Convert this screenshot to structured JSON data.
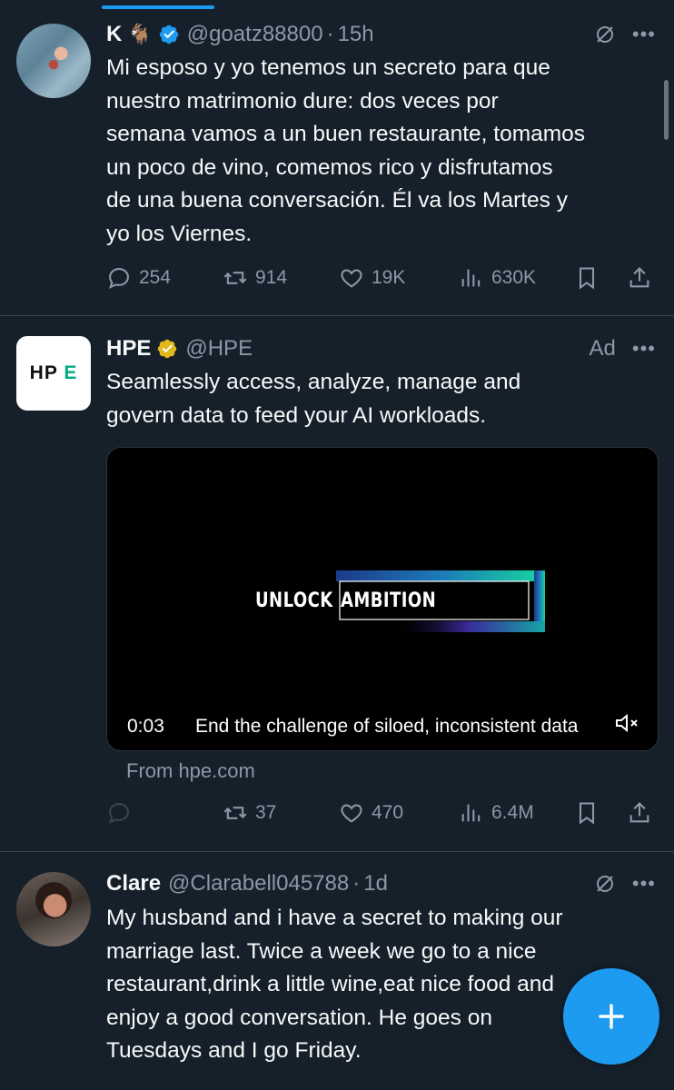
{
  "tweets": [
    {
      "name": "K",
      "handle": "@goatz88800",
      "time": "15h",
      "text": "Mi esposo y yo tenemos un secreto para que\nnuestro matrimonio dure: dos veces por\nsemana vamos a un buen restaurante, tomamos\nun poco de vino, comemos rico y disfrutamos\nde una buena conversación. Él va los Martes y\nyo los Viernes.",
      "replies": "254",
      "retweets": "914",
      "likes": "19K",
      "views": "630K"
    },
    {
      "name": "HPE",
      "handle": "@HPE",
      "ad_label": "Ad",
      "logo_text": "HPE",
      "text": "Seamlessly access, analyze, manage and\ngovern data to feed your AI workloads.",
      "video": {
        "title_word1": "UNLOCK",
        "title_word2": "AMBITION",
        "time": "0:03",
        "caption": "End the challenge of siloed, inconsistent data"
      },
      "from": "From hpe.com",
      "retweets": "37",
      "likes": "470",
      "views": "6.4M"
    },
    {
      "name": "Clare",
      "handle": "@Clarabell045788",
      "time": "1d",
      "text": "My husband and i have a secret to making our\nmarriage last. Twice a week we go to a nice\nrestaurant,drink a little wine,eat nice food and\nenjoy a good conversation. He goes on\nTuesdays and I go Friday."
    }
  ],
  "separator": "·",
  "colors": {
    "background": "#15202b",
    "accent": "#1d9bf0",
    "secondary_text": "#8b98a5",
    "verified_gold": "#e2b719",
    "hpe_green": "#01a982"
  },
  "icons": [
    "reply-icon",
    "retweet-icon",
    "like-icon",
    "views-icon",
    "bookmark-icon",
    "share-icon",
    "grok-icon",
    "more-icon",
    "verified-icon",
    "mute-icon",
    "compose-icon"
  ]
}
